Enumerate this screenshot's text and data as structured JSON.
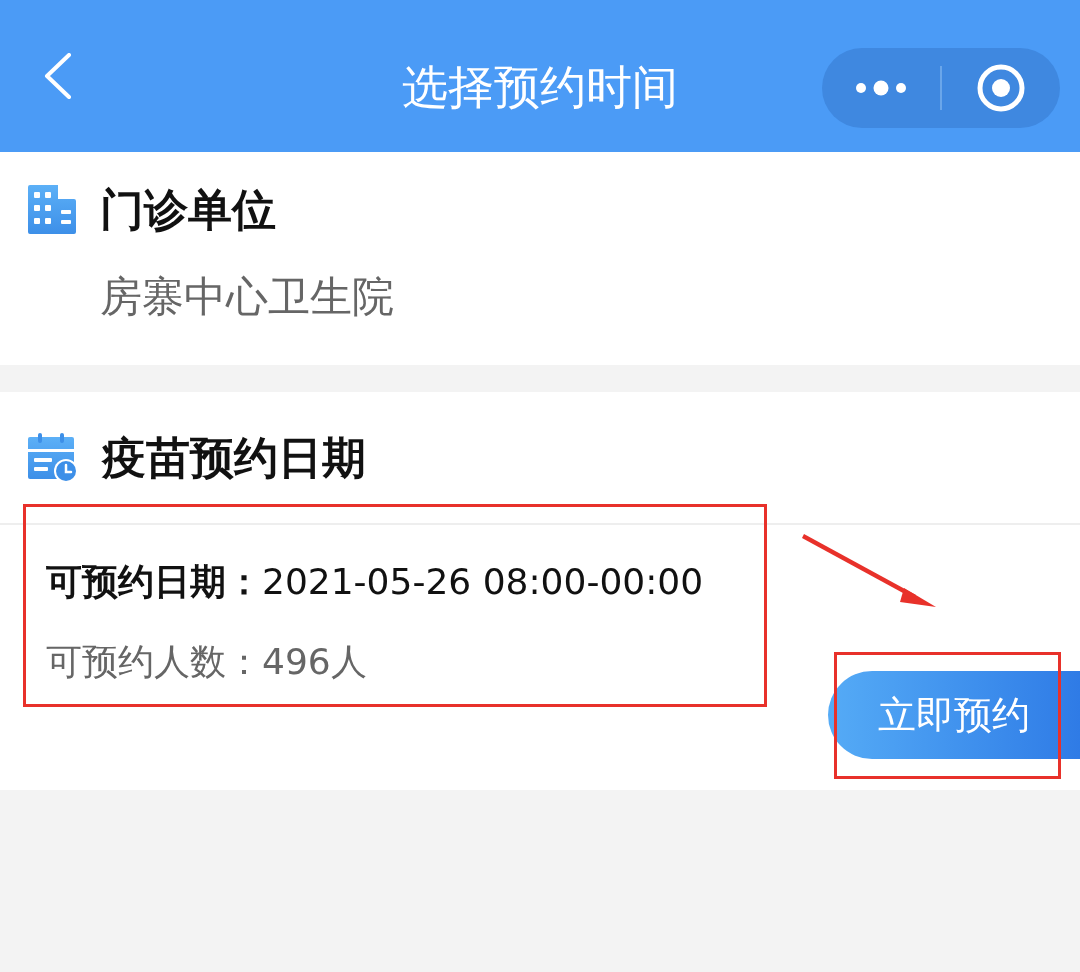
{
  "nav_bar": {
    "title": "选择预约时间"
  },
  "sections": [
    {
      "kind": "unit",
      "title": "门诊单位",
      "value": "房寨中心卫生院"
    },
    {
      "kind": "date",
      "title": "疫苗预约日期",
      "slots": [
        {
          "date_line": "**可预约日期：**2021-05-26 08:00-00:00",
          "count_line": "可预约人数：496人",
          "button": "立即预约"
        }
      ]
    }
  ]
}
